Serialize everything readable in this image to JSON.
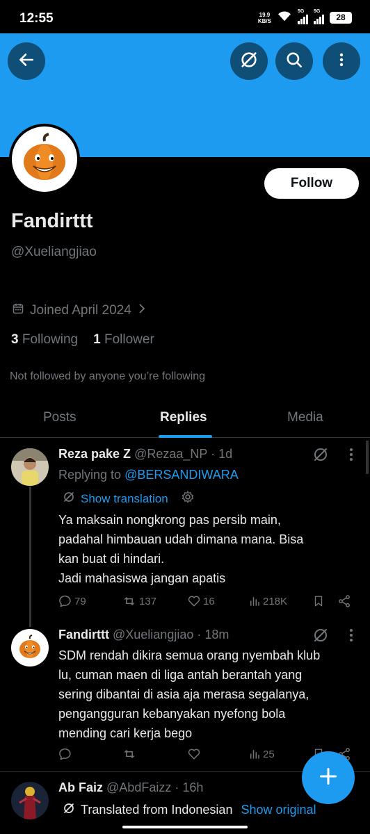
{
  "status_bar": {
    "time": "12:55",
    "net_speed": "19.9",
    "net_unit": "KB/S",
    "sig1_label": "5G",
    "sig2_label": "5G",
    "battery": "28"
  },
  "header": {
    "back_icon": "arrow-left-icon",
    "grok_icon": "grok-icon",
    "search_icon": "search-icon",
    "more_icon": "more-vertical-icon",
    "banner_color": "#1d9bf0"
  },
  "profile": {
    "name": "Fandirttt",
    "handle": "@Xueliangjiao",
    "follow_label": "Follow",
    "joined": "Joined April 2024",
    "following_count": "3",
    "following_label": "Following",
    "follower_count": "1",
    "follower_label": "Follower",
    "not_followed": "Not followed by anyone you’re following"
  },
  "tabs": [
    "Posts",
    "Replies",
    "Media"
  ],
  "active_tab": "Replies",
  "tweets": [
    {
      "name": "Reza pake Z",
      "handle": "@Rezaa_NP",
      "time": "· 1d",
      "replying_to_prefix": "Replying to",
      "replying_to": "@BERSANDIWARA",
      "show_translation": "Show translation",
      "lines": [
        "Ya maksain nongkrong pas persib main,",
        "padahal himbauan udah dimana mana. Bisa",
        "kan buat di hindari.",
        "Jadi mahasiswa jangan apatis"
      ],
      "replies": "79",
      "reposts": "137",
      "likes": "16",
      "views": "218K"
    },
    {
      "name": "Fandirttt",
      "handle": "@Xueliangjiao",
      "time": "· 18m",
      "lines": [
        "SDM rendah dikira semua orang nyembah klub",
        "lu, cuman maen di liga antah berantah yang",
        "sering dibantai di asia aja merasa segalanya,",
        "pengangguran kebanyakan nyefong bola",
        "mending cari kerja bego"
      ],
      "views": "25"
    },
    {
      "name": "Ab Faiz",
      "handle": "@AbdFaizz",
      "time": "· 16h",
      "translated_from": "Translated from Indonesian",
      "show_original": "Show original"
    }
  ],
  "fab_icon": "plus-icon",
  "accent_color": "#1d9bf0"
}
